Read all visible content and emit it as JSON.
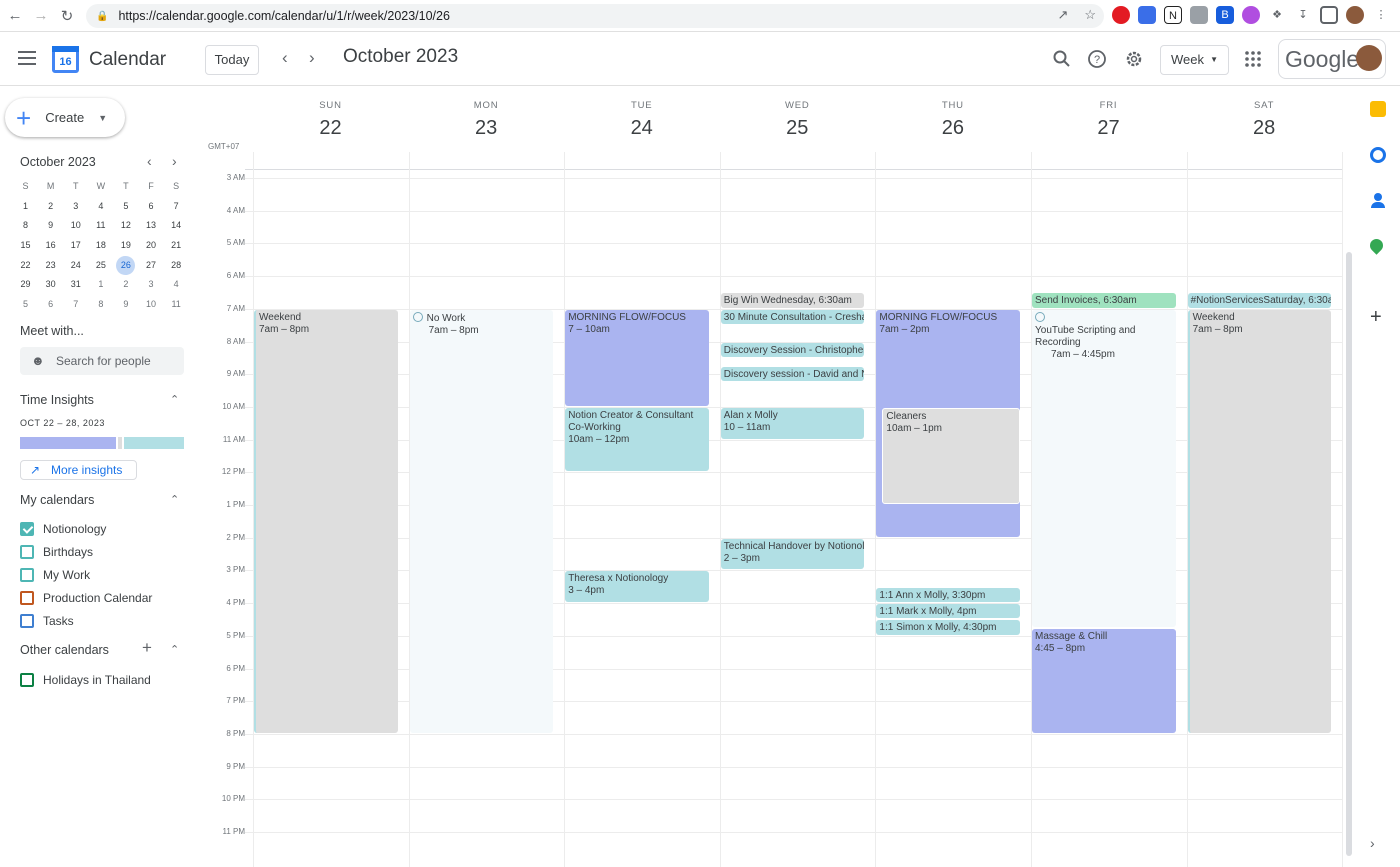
{
  "browser": {
    "url": "https://calendar.google.com/calendar/u/1/r/week/2023/10/26"
  },
  "header": {
    "app_title": "Calendar",
    "logo_day": "16",
    "today_label": "Today",
    "month_label": "October 2023",
    "view_label": "Week",
    "brand": "Google"
  },
  "sidebar": {
    "create_label": "Create",
    "mini_cal_title": "October 2023",
    "weekday_headers": [
      "S",
      "M",
      "T",
      "W",
      "T",
      "F",
      "S"
    ],
    "mini_days": [
      "1",
      "2",
      "3",
      "4",
      "5",
      "6",
      "7",
      "8",
      "9",
      "10",
      "11",
      "12",
      "13",
      "14",
      "15",
      "16",
      "17",
      "18",
      "19",
      "20",
      "21",
      "22",
      "23",
      "24",
      "25",
      "26",
      "27",
      "28",
      "29",
      "30",
      "31",
      "1",
      "2",
      "3",
      "4",
      "5",
      "6",
      "7",
      "8",
      "9",
      "10",
      "11"
    ],
    "selected_day": "26",
    "meet_title": "Meet with...",
    "search_people_placeholder": "Search for people",
    "time_insights_title": "Time Insights",
    "time_insights_range": "OCT 22 – 28, 2023",
    "more_insights_label": "More insights",
    "my_calendars_title": "My calendars",
    "my_calendars": [
      {
        "name": "Notionology",
        "checked": true,
        "color": "#4eb6b4"
      },
      {
        "name": "Birthdays",
        "checked": false,
        "color": "#4eb6b4"
      },
      {
        "name": "My Work",
        "checked": false,
        "color": "#4eb6b4"
      },
      {
        "name": "Production Calendar",
        "checked": false,
        "color": "#c0571f"
      },
      {
        "name": "Tasks",
        "checked": false,
        "color": "#3f7fd0"
      }
    ],
    "other_calendars_title": "Other calendars",
    "other_calendars": [
      {
        "name": "Holidays in Thailand",
        "checked": false,
        "color": "#0b8043"
      }
    ]
  },
  "week": {
    "timezone": "GMT+07",
    "days": [
      {
        "dow": "SUN",
        "num": "22"
      },
      {
        "dow": "MON",
        "num": "23"
      },
      {
        "dow": "TUE",
        "num": "24"
      },
      {
        "dow": "WED",
        "num": "25"
      },
      {
        "dow": "THU",
        "num": "26"
      },
      {
        "dow": "FRI",
        "num": "27"
      },
      {
        "dow": "SAT",
        "num": "28"
      }
    ],
    "hour_labels": [
      "3 AM",
      "4 AM",
      "5 AM",
      "6 AM",
      "7 AM",
      "8 AM",
      "9 AM",
      "10 AM",
      "11 AM",
      "12 PM",
      "1 PM",
      "2 PM",
      "3 PM",
      "4 PM",
      "5 PM",
      "6 PM",
      "7 PM",
      "8 PM",
      "9 PM",
      "10 PM",
      "11 PM"
    ]
  },
  "events": {
    "sun_weekend": {
      "title": "Weekend",
      "time": "7am – 8pm"
    },
    "mon_nowork": {
      "title": "No Work",
      "time": "7am – 8pm"
    },
    "tue_morning": {
      "title": "MORNING FLOW/FOCUS",
      "time": "7 – 10am"
    },
    "tue_notion": {
      "title": "Notion Creator & Consultant Co-Working",
      "time": "10am – 12pm"
    },
    "tue_theresa": {
      "title": "Theresa x Notionology",
      "time": "3 – 4pm"
    },
    "wed_bigwin": {
      "title": "Big Win Wednesday,",
      "time": "6:30am"
    },
    "wed_30min": {
      "title": "30 Minute Consultation - Cresha"
    },
    "wed_discovery1": {
      "title": "Discovery Session - Christopher"
    },
    "wed_discovery2": {
      "title": "Discovery session - David and N"
    },
    "wed_alan": {
      "title": "Alan x Molly",
      "time": "10 – 11am"
    },
    "wed_technical": {
      "title": "Technical Handover by Notionol",
      "time": "2 – 3pm"
    },
    "thu_morning": {
      "title": "MORNING FLOW/FOCUS",
      "time": "7am – 2pm"
    },
    "thu_cleaners": {
      "title": "Cleaners",
      "time": "10am – 1pm"
    },
    "thu_ann": {
      "title": "1:1 Ann x Molly,",
      "time": "3:30pm"
    },
    "thu_mark": {
      "title": "1:1 Mark x Molly,",
      "time": "4pm"
    },
    "thu_simon": {
      "title": "1:1 Simon x Molly,",
      "time": "4:30pm"
    },
    "fri_invoices": {
      "title": "Send Invoices,",
      "time": "6:30am"
    },
    "fri_youtube": {
      "title": "YouTube Scripting and Recording",
      "time": "7am – 4:45pm"
    },
    "fri_massage": {
      "title": "Massage & Chill",
      "time": "4:45 – 8pm"
    },
    "sat_notion": {
      "title": "#NotionServicesSaturday,",
      "time": "6:30a"
    },
    "sat_weekend": {
      "title": "Weekend",
      "time": "7am – 8pm"
    }
  },
  "colors": {
    "lavender": "#aab4f0",
    "teal": "#b1dfe4",
    "gray": "#dedede",
    "green": "#9fe2bf",
    "pale": "#f4f9fb",
    "accent": "#1a73e8"
  }
}
